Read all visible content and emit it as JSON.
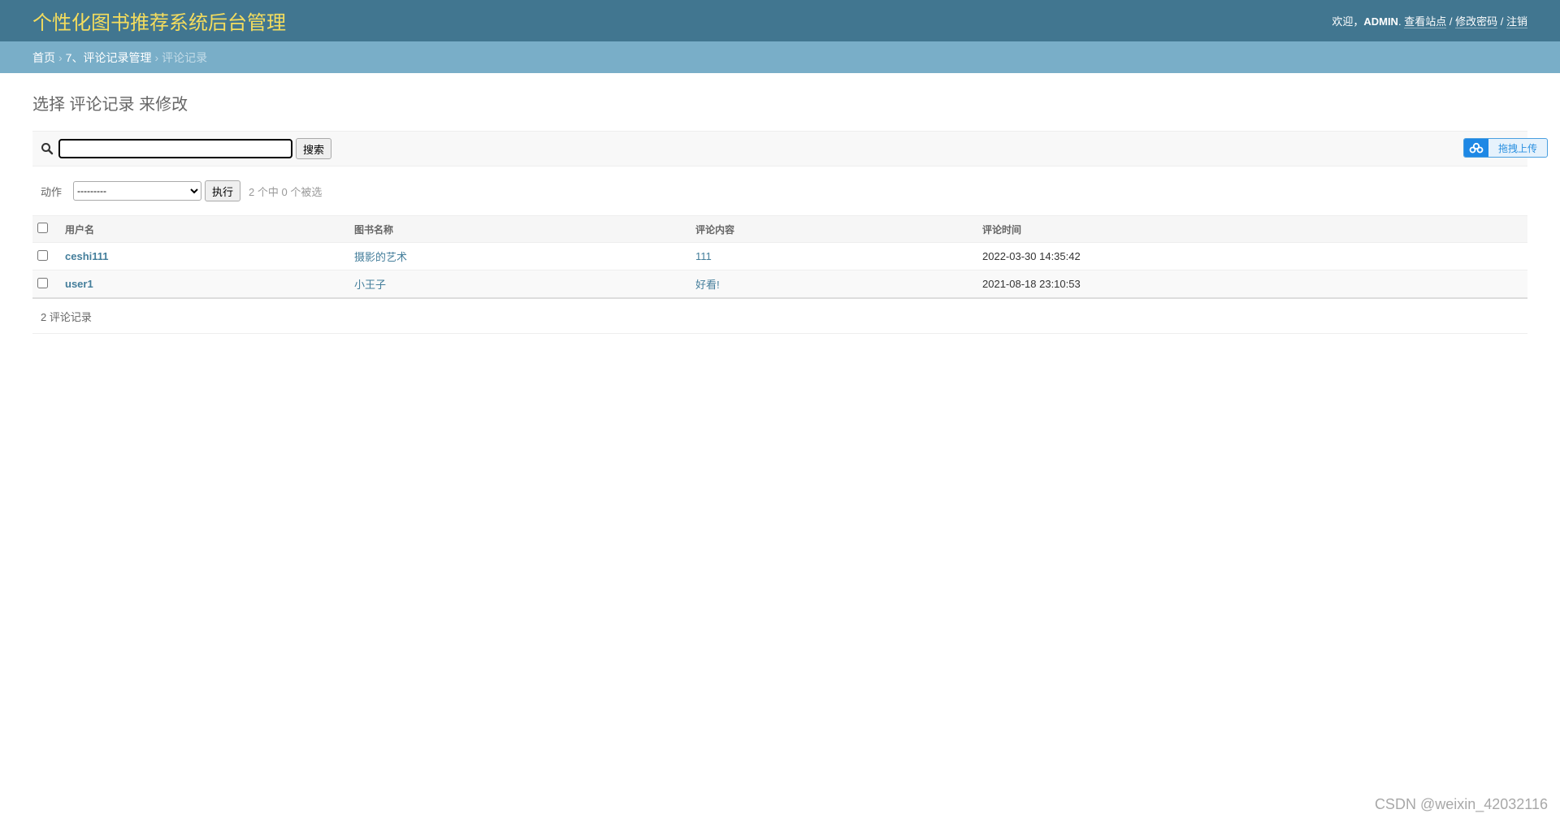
{
  "header": {
    "site_name": "个性化图书推荐系统后台管理",
    "welcome": "欢迎，",
    "username": "ADMIN",
    "view_site": "查看站点",
    "change_password": "修改密码",
    "logout": "注销",
    "sep": "/",
    "dot": ".",
    "colors": {
      "header_bg": "#417690",
      "site_name": "#f5dd5d",
      "breadcrumb_bg": "#79aec8",
      "link": "#447e9b"
    }
  },
  "breadcrumbs": {
    "home": "首页",
    "app": "7、评论记录管理",
    "current": "评论记录",
    "sep": "›"
  },
  "page": {
    "title": "选择 评论记录 来修改"
  },
  "toolbar": {
    "search_icon": "search-icon",
    "search_value": "",
    "search_button": "搜索",
    "upload_icon": "cloud-icon",
    "upload_label": "拖拽上传"
  },
  "actions": {
    "label": "动作",
    "selected_option": "---------",
    "go_button": "执行",
    "counter": "2 个中 0 个被选"
  },
  "table": {
    "columns": [
      "用户名",
      "图书名称",
      "评论内容",
      "评论时间"
    ],
    "rows": [
      {
        "user": "ceshi111",
        "book": "摄影的艺术",
        "content": "111",
        "time": "2022-03-30 14:35:42"
      },
      {
        "user": "user1",
        "book": "小王子",
        "content": "好看!",
        "time": "2021-08-18 23:10:53"
      }
    ]
  },
  "paginator": {
    "text": "2 评论记录"
  },
  "watermark": "CSDN @weixin_42032116"
}
